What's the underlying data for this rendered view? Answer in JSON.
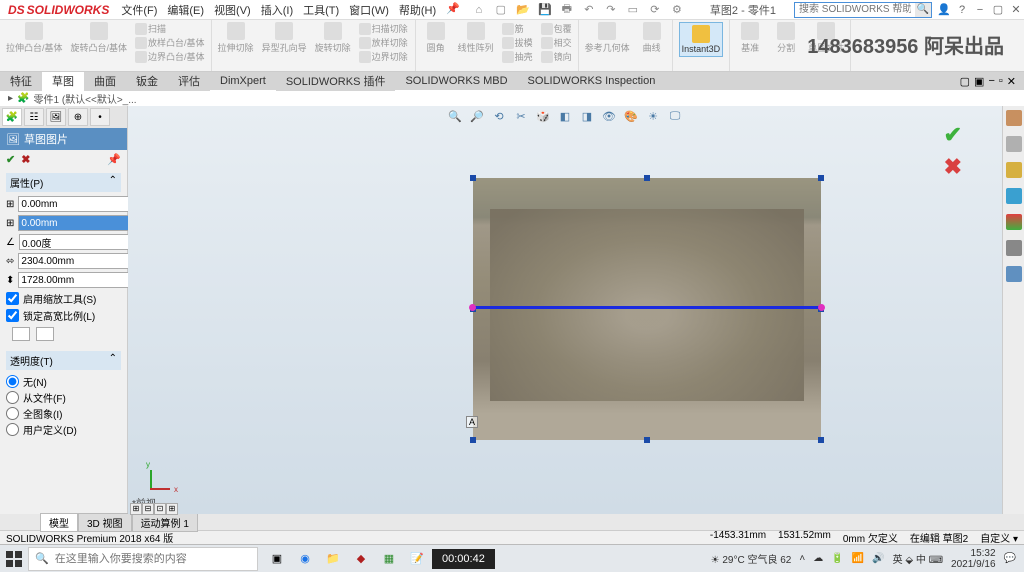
{
  "app": {
    "logo": "SOLIDWORKS",
    "title": "草图2 - 零件1",
    "search_placeholder": "搜索 SOLIDWORKS 帮助"
  },
  "menus": [
    "文件(F)",
    "编辑(E)",
    "视图(V)",
    "插入(I)",
    "工具(T)",
    "窗口(W)",
    "帮助(H)"
  ],
  "ribbon": {
    "groups": [
      [
        "拉伸凸台/基体",
        "旋转凸台/基体",
        "",
        "扫描",
        "放样凸台/基体",
        "边界凸台/基体"
      ],
      [
        "拉伸切除",
        "异型孔向导",
        "旋转切除",
        "",
        "扫描切除",
        "放样切除",
        "边界切除"
      ],
      [
        "圆角",
        "线性阵列",
        "",
        "筋",
        "拔模",
        "抽壳",
        "包覆",
        "相交",
        "镜向"
      ],
      [
        "参考几何体",
        "曲线"
      ],
      [
        "Instant3D"
      ],
      [
        "基准",
        "分割",
        "单图文件"
      ]
    ],
    "active_label": "Instant3D"
  },
  "watermark": "1483683956 阿呆出品",
  "tabs": [
    "特征",
    "草图",
    "曲面",
    "钣金",
    "评估",
    "DimXpert",
    "SOLIDWORKS 插件",
    "SOLIDWORKS MBD",
    "SOLIDWORKS Inspection"
  ],
  "tabs_active": 1,
  "breadcrumb": "零件1 (默认<<默认>_...",
  "panel": {
    "header": "草图图片",
    "section_props": "属性(P)",
    "fields": {
      "x": "0.00mm",
      "y": "0.00mm",
      "angle": "0.00度",
      "w": "2304.00mm",
      "h": "1728.00mm"
    },
    "highlight_index": 1,
    "checks": {
      "tool": "启用缩放工具(S)",
      "lock": "锁定高宽比例(L)"
    },
    "section_trans": "透明度(T)",
    "radios": [
      "无(N)",
      "从文件(F)",
      "全图象(I)",
      "用户定义(D)"
    ],
    "radio_selected": 0
  },
  "viewport": {
    "a_label": "A",
    "view_label": "*前视",
    "triad_x": "x",
    "triad_y": "y"
  },
  "bottom_tabs": [
    "模型",
    "3D 视图",
    "运动算例 1"
  ],
  "bottom_active": 0,
  "status": {
    "left": "SOLIDWORKS Premium 2018 x64 版",
    "right": [
      "-1453.31mm",
      "1531.52mm",
      "0mm 欠定义",
      "在编辑 草图2",
      "自定义 ▾"
    ]
  },
  "taskbar": {
    "search_placeholder": "在这里输入你要搜索的内容",
    "timer": "00:00:42",
    "weather": "29°C 空气良 62",
    "ime": "英 ⬙ 中 ⌨",
    "time": "15:32",
    "date": "2021/9/16"
  }
}
